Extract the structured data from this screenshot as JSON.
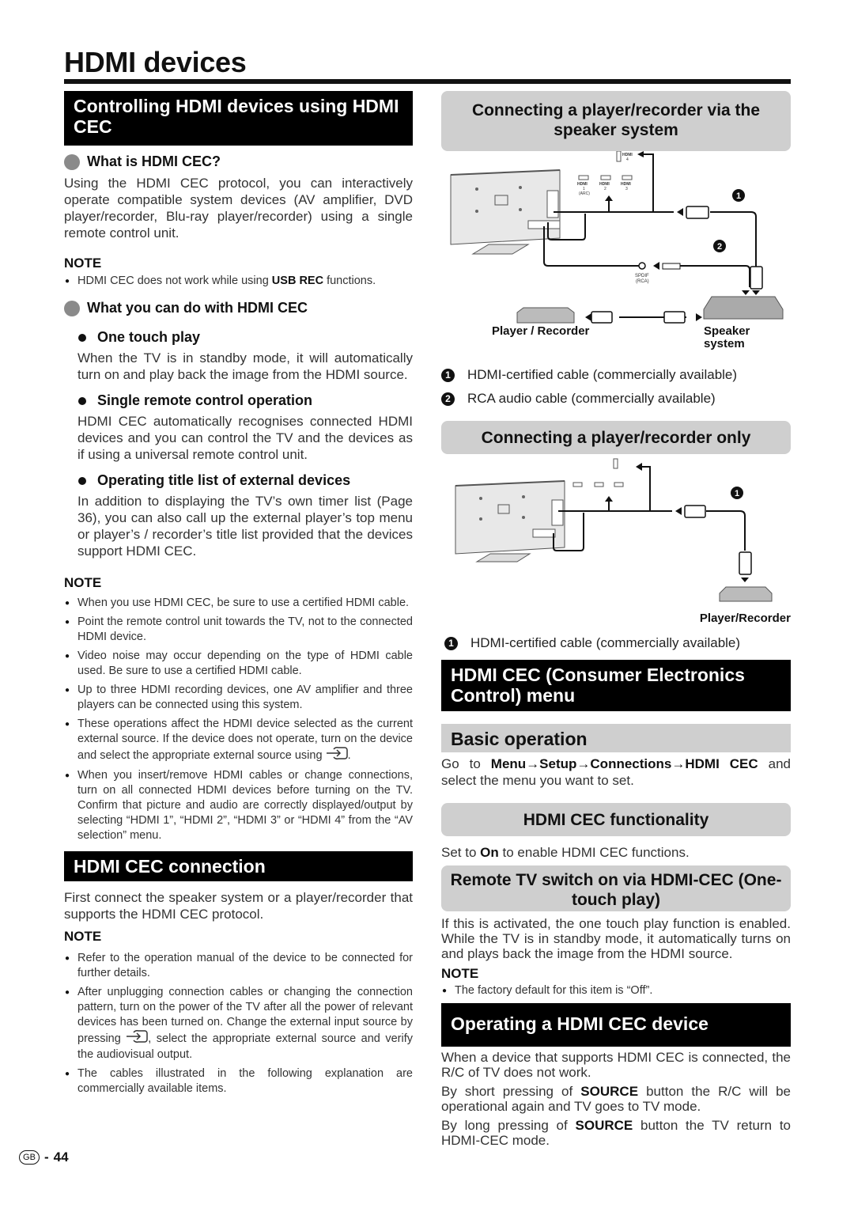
{
  "page": {
    "title": "HDMI devices",
    "footer": {
      "region_badge": "GB",
      "separator": "-",
      "page_number": "44"
    }
  },
  "left": {
    "section1": {
      "heading": "Controlling HDMI devices using HDMI CEC",
      "what_is": {
        "heading": "What is HDMI CEC?",
        "body": "Using the HDMI CEC protocol, you can interactively operate compatible system devices (AV amplifier, DVD player/recorder, Blu-ray player/recorder) using a single remote control unit."
      },
      "note1": {
        "label": "NOTE",
        "items": [
          {
            "pre": "HDMI CEC does not work while using ",
            "bold": "USB REC",
            "post": " functions."
          }
        ]
      },
      "what_can": {
        "heading": "What you can do with HDMI CEC",
        "items": [
          {
            "title": "One touch play",
            "body": "When the TV is in standby mode, it will automatically turn on and play back the image from the HDMI source."
          },
          {
            "title": "Single remote control operation",
            "body": "HDMI CEC automatically recognises connected HDMI devices and you can control the TV and the devices as if using a universal remote control unit."
          },
          {
            "title": "Operating title list of external devices",
            "body": "In addition to displaying the TV’s own timer list (Page 36), you can also call up the external player’s top menu or player’s / recorder’s title list provided that the devices support HDMI CEC."
          }
        ]
      },
      "note2": {
        "label": "NOTE",
        "items": [
          "When you use HDMI CEC, be sure to use a certified HDMI cable.",
          "Point the remote control unit towards the TV, not to the connected HDMI device.",
          "Video noise may occur depending on the type of HDMI cable used. Be sure to use a certified HDMI cable.",
          "Up to three HDMI recording devices, one AV amplifier and three players can be connected using this system.",
          "These operations affect the HDMI device selected as the current external source. If the device does not operate, turn on the device and select the appropriate external source using",
          "When you insert/remove HDMI cables or change connections, turn on all connected HDMI devices before turning on the TV. Confirm that picture and audio are correctly displayed/output by selecting “HDMI 1”, “HDMI 2”, “HDMI 3” or “HDMI 4” from the “AV selection” menu."
        ],
        "item5_suffix": "."
      }
    },
    "section2": {
      "heading": "HDMI CEC connection",
      "body": "First connect the speaker system or a player/recorder that supports the HDMI CEC protocol.",
      "note": {
        "label": "NOTE",
        "items": [
          "Refer to the operation manual of the device to be connected for further details.",
          "The cables illustrated in the following explanation are commercially available items."
        ],
        "item2_pre": "After unplugging connection cables or changing the connection pattern, turn on the power of the TV after all the power of relevant devices has been turned on. Change the external input source by pressing",
        "item2_post": ", select the appropriate external source and verify the audiovisual output."
      }
    }
  },
  "right": {
    "speaker": {
      "heading": "Connecting a player/recorder via the speaker system",
      "diagram": {
        "ports": [
          "HDMI 1 (ARC)",
          "HDMI 2",
          "HDMI 3",
          "HDMI 4"
        ],
        "port_labels": {
          "hdmi": "HDMI",
          "p1": "1",
          "arc": "(ARC)",
          "p2": "2",
          "p3": "3",
          "p4": "4"
        },
        "spdif_label": "SPDIF",
        "rca_label": "(RCA)",
        "player_label": "Player / Recorder",
        "speaker_label_1": "Speaker",
        "speaker_label_2": "system",
        "callout_1": "1",
        "callout_2": "2"
      },
      "legend": [
        {
          "num": "1",
          "text": "HDMI-certified cable (commercially available)"
        },
        {
          "num": "2",
          "text": "RCA audio cable (commercially available)"
        }
      ]
    },
    "player_only": {
      "heading": "Connecting a player/recorder only",
      "diagram": {
        "player_label": "Player/Recorder",
        "callout_1": "1"
      },
      "legend": [
        {
          "num": "1",
          "text": "HDMI-certified cable (commercially available)"
        }
      ]
    },
    "menu": {
      "heading": "HDMI CEC (Consumer Electronics Control) menu",
      "basic": {
        "heading": "Basic operation",
        "pre": "Go to ",
        "path": "Menu→Setup→Connections→HDMI CEC",
        "post": " and select the menu you want to set."
      },
      "functionality": {
        "heading": "HDMI CEC functionality",
        "pre": "Set to ",
        "bold": "On",
        "post": " to enable HDMI CEC functions."
      },
      "remote": {
        "heading": "Remote TV switch on via HDMI-CEC (One-touch play)",
        "body": "If this is activated, the one touch play function is enabled. While the TV is in standby mode, it automatically turns on and plays back the image from the HDMI source.",
        "note_label": "NOTE",
        "note_item": "The factory default for this item is “Off”."
      }
    },
    "operating": {
      "heading": "Operating a HDMI CEC device",
      "p1": "When a device that supports HDMI CEC is connected, the R/C of TV does not work.",
      "p2_pre": "By short pressing of ",
      "p2_bold": "SOURCE",
      "p2_post": " button the R/C will be operational again and TV goes to TV mode.",
      "p3_pre": "By long pressing of ",
      "p3_bold": "SOURCE",
      "p3_post": " button the TV return to HDMI-CEC mode."
    }
  }
}
